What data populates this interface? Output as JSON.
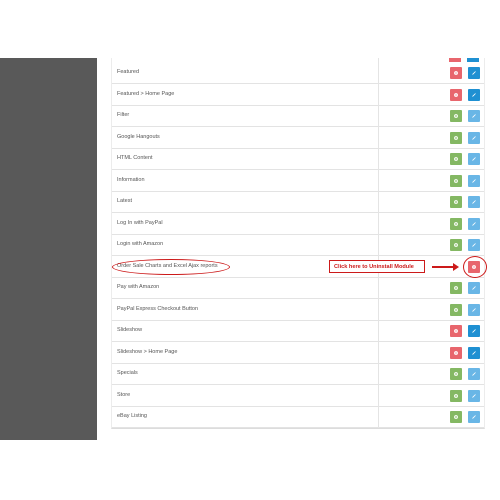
{
  "colors": {
    "red": "#e8666d",
    "green": "#84b863",
    "blue": "#1f90d2",
    "lightblue": "#69b6e6",
    "annotation": "#cc1a1a"
  },
  "annotation": {
    "label": "Click here to Uninstall Module"
  },
  "modules": [
    {
      "name": "Featured",
      "a": "red",
      "b": "blue"
    },
    {
      "name": "Featured > Home Page",
      "a": "red",
      "b": "blue"
    },
    {
      "name": "Filter",
      "a": "green",
      "b": "lightblue"
    },
    {
      "name": "Google Hangouts",
      "a": "green",
      "b": "lightblue"
    },
    {
      "name": "HTML Content",
      "a": "green",
      "b": "lightblue"
    },
    {
      "name": "Information",
      "a": "green",
      "b": "lightblue"
    },
    {
      "name": "Latest",
      "a": "green",
      "b": "lightblue"
    },
    {
      "name": "Log In with PayPal",
      "a": "green",
      "b": "lightblue"
    },
    {
      "name": "Login with Amazon",
      "a": "green",
      "b": "lightblue"
    },
    {
      "name": "Order Sale Charts and Excel Ajax reports",
      "a": "red",
      "b": "none"
    },
    {
      "name": "Pay with Amazon",
      "a": "green",
      "b": "lightblue"
    },
    {
      "name": "PayPal Express Checkout Button",
      "a": "green",
      "b": "lightblue"
    },
    {
      "name": "Slideshow",
      "a": "red",
      "b": "blue"
    },
    {
      "name": "Slideshow > Home Page",
      "a": "red",
      "b": "blue"
    },
    {
      "name": "Specials",
      "a": "green",
      "b": "lightblue"
    },
    {
      "name": "Store",
      "a": "green",
      "b": "lightblue"
    },
    {
      "name": "eBay Listing",
      "a": "green",
      "b": "lightblue"
    }
  ]
}
